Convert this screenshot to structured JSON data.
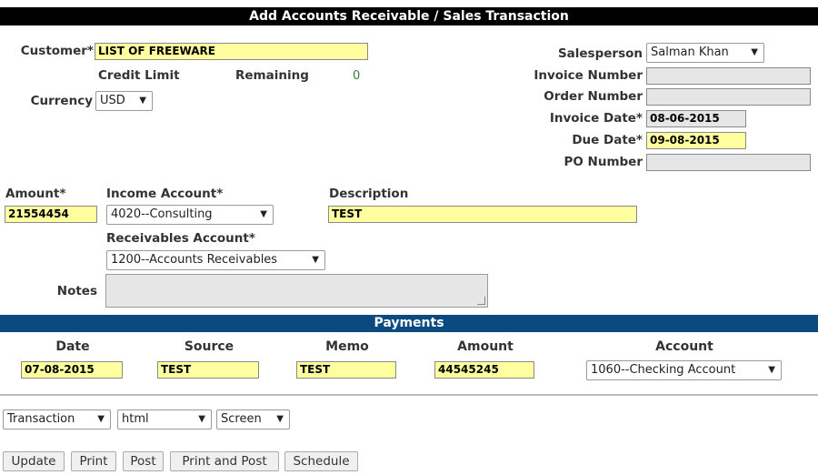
{
  "title": "Add Accounts Receivable / Sales Transaction",
  "customer": {
    "label": "Customer*",
    "value": "LIST OF FREEWARE"
  },
  "credit_limit": {
    "label": "Credit Limit",
    "value": ""
  },
  "remaining": {
    "label": "Remaining",
    "value": "0"
  },
  "currency": {
    "label": "Currency",
    "value": "USD"
  },
  "salesperson": {
    "label": "Salesperson",
    "value": "Salman Khan"
  },
  "invoice_number": {
    "label": "Invoice Number",
    "value": ""
  },
  "order_number": {
    "label": "Order Number",
    "value": ""
  },
  "invoice_date": {
    "label": "Invoice Date*",
    "value": "08-06-2015"
  },
  "due_date": {
    "label": "Due Date*",
    "value": "09-08-2015"
  },
  "po_number": {
    "label": "PO Number",
    "value": ""
  },
  "amount": {
    "label": "Amount*",
    "value": "21554454"
  },
  "income_account": {
    "label": "Income Account*",
    "value": "4020--Consulting"
  },
  "description": {
    "label": "Description",
    "value": "TEST"
  },
  "receivables_account": {
    "label": "Receivables Account*",
    "value": "1200--Accounts Receivables"
  },
  "notes": {
    "label": "Notes",
    "value": ""
  },
  "payments": {
    "title": "Payments",
    "headers": {
      "date": "Date",
      "source": "Source",
      "memo": "Memo",
      "amount": "Amount",
      "account": "Account"
    },
    "row": {
      "date": "07-08-2015",
      "source": "TEST",
      "memo": "TEST",
      "amount": "44545245",
      "account": "1060--Checking Account"
    }
  },
  "output": {
    "type": "Transaction",
    "format": "html",
    "media": "Screen"
  },
  "buttons": {
    "update": "Update",
    "print": "Print",
    "post": "Post",
    "print_and_post": "Print and Post",
    "schedule": "Schedule"
  },
  "colors": {
    "title_bar": "#000000",
    "payments_bar": "#0a4a80",
    "required_field": "#ffffa0",
    "readonly_field": "#e6e6e6",
    "remaining_value": "#3a7d3a"
  },
  "icons": {
    "dropdown": "triangle-down"
  }
}
